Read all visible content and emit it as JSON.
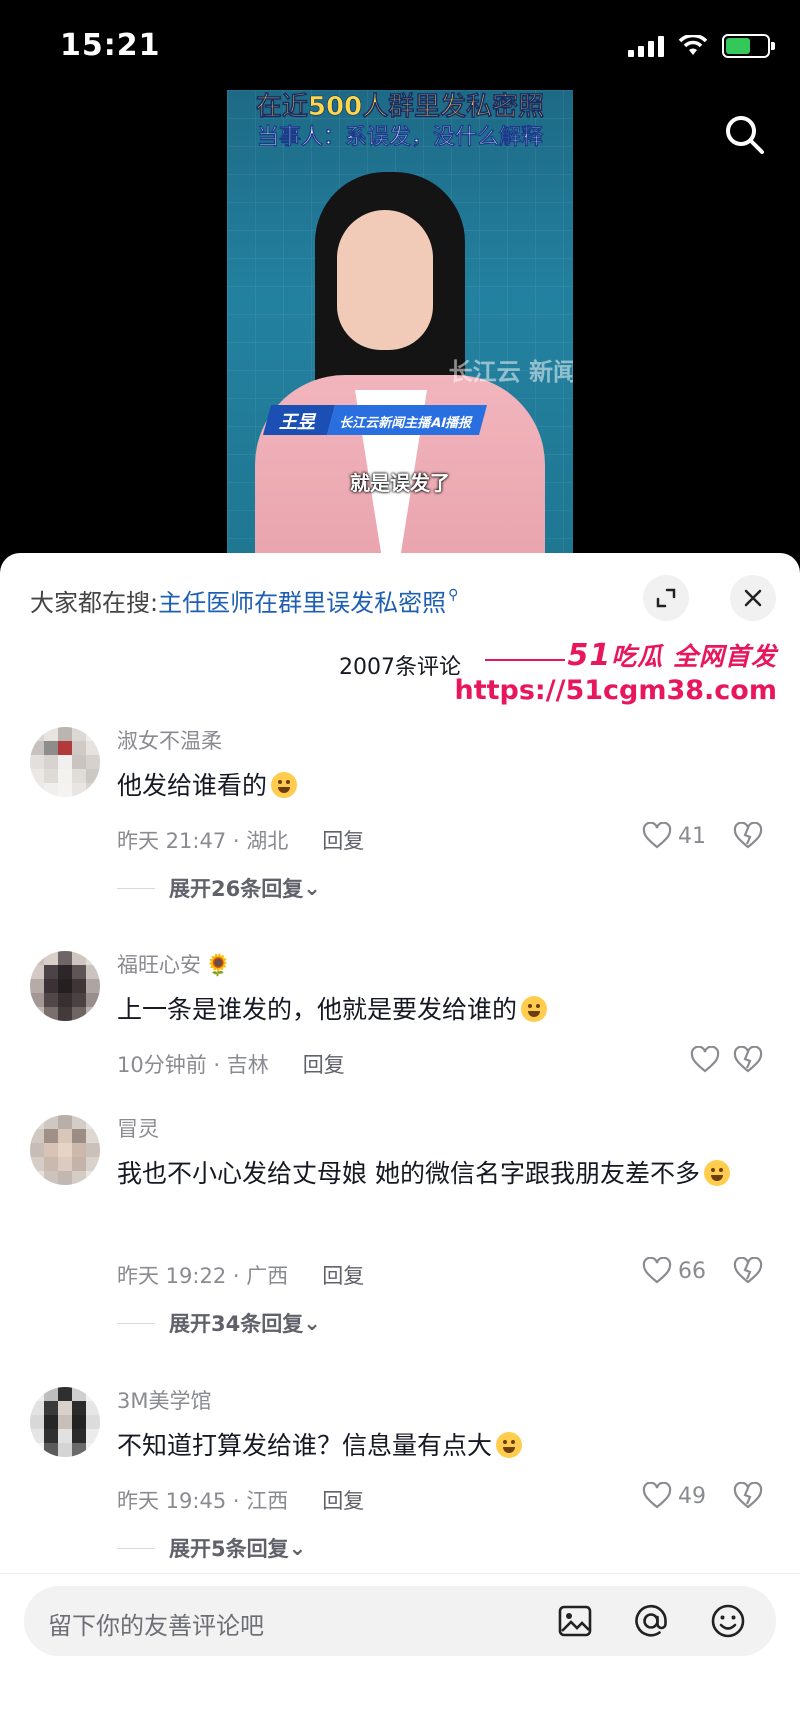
{
  "status_bar": {
    "time": "15:21",
    "battery_level": 0.6
  },
  "video": {
    "headline_1": "在近500人群里发私密照",
    "headline_2": "当事人：系误发，没什么解释",
    "name": "王昱",
    "name_title": "长江云新闻主播AI播报",
    "watermark": "长江云 新闻",
    "subtitle": "就是误发了"
  },
  "hot_search": {
    "prefix": "大家都在搜:",
    "query": "主任医师在群里误发私密照"
  },
  "comment_count": "2007条评论",
  "promo": {
    "brand_num": "51",
    "brand": "吃瓜 全网首发",
    "url": "https://51cgm38.com"
  },
  "comments": [
    {
      "user": "淑女不温柔",
      "badge": "",
      "text": "他发给谁看的",
      "time": "昨天 21:47 · 湖北",
      "reply": "回复",
      "likes": "41",
      "expand": "展开26条回复"
    },
    {
      "user": "福旺心安",
      "badge": "🌻",
      "text": "上一条是谁发的，他就是要发给谁的",
      "time": "10分钟前 · 吉林",
      "reply": "回复",
      "likes": "",
      "expand": ""
    },
    {
      "user": "冒灵",
      "badge": "",
      "text": "我也不小心发给丈母娘 她的微信名字跟我朋友差不多",
      "time": "昨天 19:22 · 广西",
      "reply": "回复",
      "likes": "66",
      "expand": "展开34条回复"
    },
    {
      "user": "3M美学馆",
      "badge": "",
      "text": "不知道打算发给谁？信息量有点大",
      "time": "昨天 19:45 · 江西",
      "reply": "回复",
      "likes": "49",
      "expand": "展开5条回复"
    }
  ],
  "input": {
    "placeholder": "留下你的友善评论吧"
  },
  "icons": [
    "search-icon",
    "expand-icon",
    "close-icon",
    "heart-icon",
    "dislike-heart-icon",
    "image-icon",
    "at-icon",
    "emoji-icon"
  ]
}
